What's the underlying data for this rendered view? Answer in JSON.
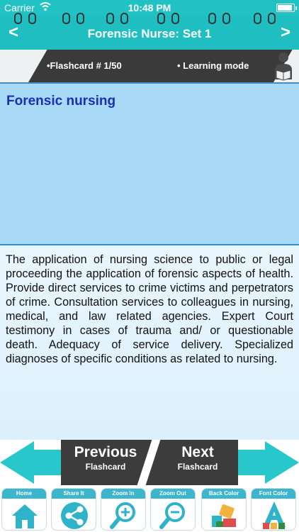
{
  "status_bar": {
    "carrier": "Carrier",
    "time": "10:48 PM",
    "battery_level": 0.9
  },
  "nav": {
    "title": "Forensic Nurse: Set 1",
    "back_symbol": "<",
    "forward_symbol": ">"
  },
  "info_bar": {
    "flashcard_label": "•Flashcard #  1/50",
    "mode_label": "• Learning mode",
    "icon": "reader-icon"
  },
  "card": {
    "term": "Forensic nursing",
    "definition": "The application of nursing science to public or legal proceeding the application of forensic aspects of health. Provide direct services to crime victims and perpetrators of crime. Consultation services to colleagues in nursing, medical, and law related agencies. Expert Court testimony in cases of trauma and/ or questionable death. Adequacy of service delivery. Specialized diagnoses of specific conditions as related to nursing."
  },
  "pager": {
    "previous_main": "Previous",
    "previous_sub": "Flashcard",
    "next_main": "Next",
    "next_sub": "Flashcard"
  },
  "toolbar": {
    "items": [
      {
        "label": "Home",
        "icon": "home-icon"
      },
      {
        "label": "Share It",
        "icon": "share-icon"
      },
      {
        "label": "Zoom In",
        "icon": "zoom-in-icon"
      },
      {
        "label": "Zoom Out",
        "icon": "zoom-out-icon"
      },
      {
        "label": "Back Color",
        "icon": "back-color-icon"
      },
      {
        "label": "Font Color",
        "icon": "font-color-icon"
      }
    ]
  },
  "colors": {
    "accent": "#1fbfc1",
    "term_panel": "#a8d9f7",
    "term_text": "#1a2fb5",
    "dark_band": "#3a3a3a"
  }
}
